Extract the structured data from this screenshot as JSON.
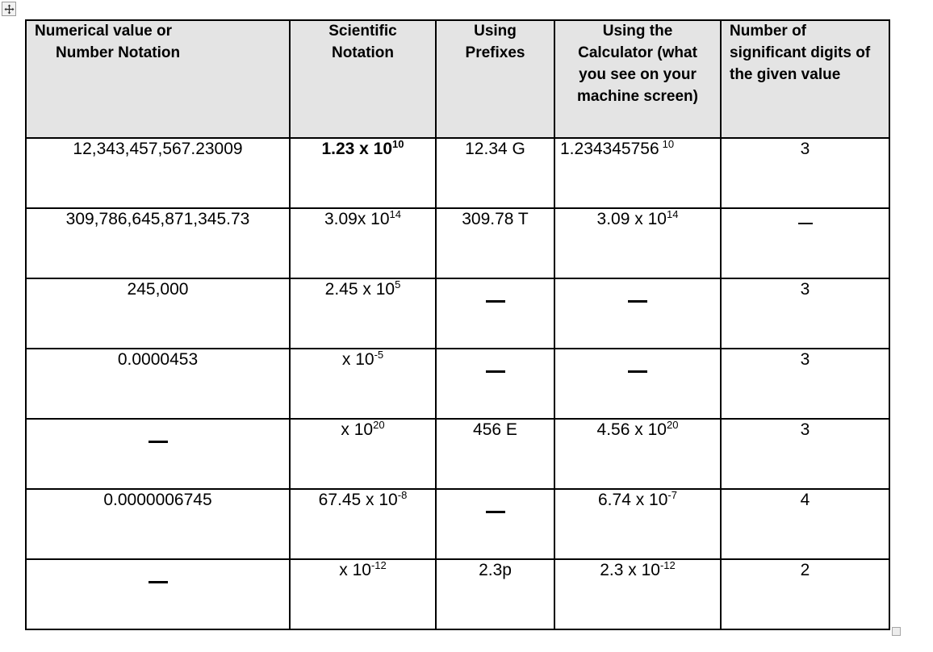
{
  "document": {
    "title": "Scientific Notation Worksheet Table",
    "move_handle_icon": "move-arrows-icon",
    "resize_handle_icon": "table-resize-handle-icon"
  },
  "table": {
    "headers": [
      {
        "line1": "Numerical value or",
        "line2": "Number Notation",
        "align": "left"
      },
      {
        "line1": "Scientific",
        "line2": "Notation",
        "align": "center"
      },
      {
        "line1": "Using",
        "line2": "Prefixes",
        "align": "center"
      },
      {
        "line1": "Using the",
        "line2": "Calculator (what",
        "line3": "you see on your",
        "line4": "machine screen)",
        "align": "center"
      },
      {
        "line1": "Number of",
        "line2": "significant digits of",
        "line3": "the given value",
        "align": "left"
      }
    ],
    "rows": [
      {
        "value": "12,343,457,567.23009",
        "sci_mantissa": "1.23 x 10",
        "sci_exp": "10",
        "prefix": "12.34 G",
        "calc_mantissa": "1.234345756",
        "calc_exp": "10",
        "sig_digits": "3"
      },
      {
        "value": "309,786,645,871,345.73",
        "sci_mantissa": "3.09x 10",
        "sci_exp": "14",
        "prefix": "309.78 T",
        "calc_mantissa": "3.09 x 10",
        "calc_exp": "14",
        "sig_digits": "–"
      },
      {
        "value": "245,000",
        "sci_mantissa": "2.45 x 10",
        "sci_exp": "5",
        "prefix": "—",
        "calc_mantissa": "—",
        "calc_exp": "",
        "sig_digits": "3"
      },
      {
        "value": "0.0000453",
        "sci_mantissa": "x 10",
        "sci_exp": "-5",
        "prefix": "—",
        "calc_mantissa": "—",
        "calc_exp": "",
        "sig_digits": "3"
      },
      {
        "value": "—",
        "sci_mantissa": "x 10",
        "sci_exp": "20",
        "prefix": "456 E",
        "calc_mantissa": "4.56 x 10",
        "calc_exp": "20",
        "sig_digits": "3"
      },
      {
        "value": "0.0000006745",
        "sci_mantissa": "67.45 x 10",
        "sci_exp": "-8",
        "prefix": "—",
        "calc_mantissa": "6.74 x 10",
        "calc_exp": "-7",
        "sig_digits": "4"
      },
      {
        "value": "—",
        "sci_mantissa": "x 10",
        "sci_exp": "-12",
        "prefix": "2.3p",
        "calc_mantissa": "2.3 x 10",
        "calc_exp": "-12",
        "sig_digits": "2"
      }
    ]
  }
}
